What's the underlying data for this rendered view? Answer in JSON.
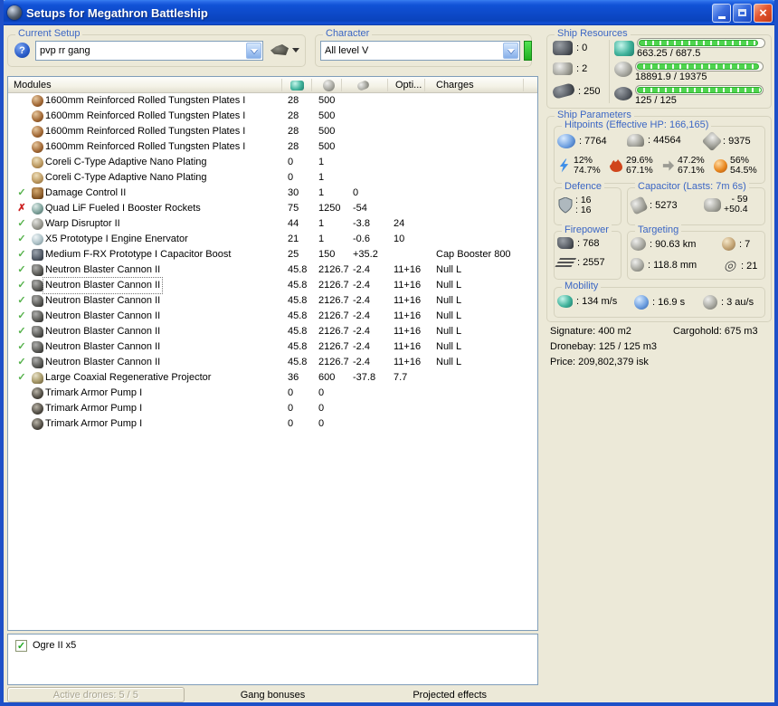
{
  "window_title": "Setups for Megathron Battleship",
  "current_setup": {
    "label": "Current Setup",
    "value": "pvp rr gang"
  },
  "character": {
    "label": "Character",
    "value": "All level V"
  },
  "modules_table": {
    "modules_header": "Modules",
    "opti_header": "Opti...",
    "charges_header": "Charges",
    "rows": [
      {
        "state": "",
        "icon": "armor-plate",
        "name": "1600mm Reinforced Rolled Tungsten Plates I",
        "cpu": "28",
        "pg": "500",
        "cap": "",
        "opti": "",
        "charges": ""
      },
      {
        "state": "",
        "icon": "armor-plate",
        "name": "1600mm Reinforced Rolled Tungsten Plates I",
        "cpu": "28",
        "pg": "500",
        "cap": "",
        "opti": "",
        "charges": ""
      },
      {
        "state": "",
        "icon": "armor-plate",
        "name": "1600mm Reinforced Rolled Tungsten Plates I",
        "cpu": "28",
        "pg": "500",
        "cap": "",
        "opti": "",
        "charges": ""
      },
      {
        "state": "",
        "icon": "armor-plate",
        "name": "1600mm Reinforced Rolled Tungsten Plates I",
        "cpu": "28",
        "pg": "500",
        "cap": "",
        "opti": "",
        "charges": ""
      },
      {
        "state": "",
        "icon": "adaptive-nano",
        "name": "Coreli C-Type Adaptive Nano Plating",
        "cpu": "0",
        "pg": "1",
        "cap": "",
        "opti": "",
        "charges": ""
      },
      {
        "state": "",
        "icon": "adaptive-nano",
        "name": "Coreli C-Type Adaptive Nano Plating",
        "cpu": "0",
        "pg": "1",
        "cap": "",
        "opti": "",
        "charges": ""
      },
      {
        "state": "check",
        "icon": "damage-control",
        "name": "Damage Control II",
        "cpu": "30",
        "pg": "1",
        "cap": "0",
        "opti": "",
        "charges": ""
      },
      {
        "state": "cross",
        "icon": "booster-rockets",
        "name": "Quad LiF Fueled I Booster Rockets",
        "cpu": "75",
        "pg": "1250",
        "cap": "-54",
        "opti": "",
        "charges": ""
      },
      {
        "state": "check",
        "icon": "warp-disruptor",
        "name": "Warp Disruptor II",
        "cpu": "44",
        "pg": "1",
        "cap": "-3.8",
        "opti": "24",
        "charges": ""
      },
      {
        "state": "check",
        "icon": "stasis-web",
        "name": "X5 Prototype I Engine Enervator",
        "cpu": "21",
        "pg": "1",
        "cap": "-0.6",
        "opti": "10",
        "charges": ""
      },
      {
        "state": "check",
        "icon": "cap-booster",
        "name": "Medium F-RX Prototype I Capacitor Boost",
        "cpu": "25",
        "pg": "150",
        "cap": "+35.2",
        "opti": "",
        "charges": "Cap Booster 800"
      },
      {
        "state": "check",
        "icon": "blaster-turret",
        "name": "Neutron Blaster Cannon II",
        "cpu": "45.8",
        "pg": "2126.7",
        "cap": "-2.4",
        "opti": "11+16",
        "charges": "Null L"
      },
      {
        "state": "check",
        "icon": "blaster-turret",
        "name": "Neutron Blaster Cannon II",
        "cpu": "45.8",
        "pg": "2126.7",
        "cap": "-2.4",
        "opti": "11+16",
        "charges": "Null L",
        "focused": true
      },
      {
        "state": "check",
        "icon": "blaster-turret",
        "name": "Neutron Blaster Cannon II",
        "cpu": "45.8",
        "pg": "2126.7",
        "cap": "-2.4",
        "opti": "11+16",
        "charges": "Null L"
      },
      {
        "state": "check",
        "icon": "blaster-turret",
        "name": "Neutron Blaster Cannon II",
        "cpu": "45.8",
        "pg": "2126.7",
        "cap": "-2.4",
        "opti": "11+16",
        "charges": "Null L"
      },
      {
        "state": "check",
        "icon": "blaster-turret",
        "name": "Neutron Blaster Cannon II",
        "cpu": "45.8",
        "pg": "2126.7",
        "cap": "-2.4",
        "opti": "11+16",
        "charges": "Null L"
      },
      {
        "state": "check",
        "icon": "blaster-turret",
        "name": "Neutron Blaster Cannon II",
        "cpu": "45.8",
        "pg": "2126.7",
        "cap": "-2.4",
        "opti": "11+16",
        "charges": "Null L"
      },
      {
        "state": "check",
        "icon": "blaster-turret",
        "name": "Neutron Blaster Cannon II",
        "cpu": "45.8",
        "pg": "2126.7",
        "cap": "-2.4",
        "opti": "11+16",
        "charges": "Null L"
      },
      {
        "state": "check",
        "icon": "remote-repairer",
        "name": "Large Coaxial Regenerative Projector",
        "cpu": "36",
        "pg": "600",
        "cap": "-37.8",
        "opti": "7.7",
        "charges": ""
      },
      {
        "state": "",
        "icon": "armor-rig",
        "name": "Trimark Armor Pump I",
        "cpu": "0",
        "pg": "0",
        "cap": "",
        "opti": "",
        "charges": ""
      },
      {
        "state": "",
        "icon": "armor-rig",
        "name": "Trimark Armor Pump I",
        "cpu": "0",
        "pg": "0",
        "cap": "",
        "opti": "",
        "charges": ""
      },
      {
        "state": "",
        "icon": "armor-rig",
        "name": "Trimark Armor Pump I",
        "cpu": "0",
        "pg": "0",
        "cap": "",
        "opti": "",
        "charges": ""
      }
    ]
  },
  "drones_panel": {
    "items": [
      {
        "checked": true,
        "label": "Ogre II x5"
      }
    ]
  },
  "bottom_tabs": {
    "active_drones": "Active drones: 5 / 5",
    "gang_bonuses": "Gang bonuses",
    "projected_effects": "Projected effects"
  },
  "ship_resources": {
    "label": "Ship Resources",
    "turret_slots": ": 0",
    "launcher_slots": ": 2",
    "calibration": ": 250",
    "cpu_text": "663.25 / 687.5",
    "cpu_pct": 96,
    "powergrid_text": "18891.9 / 19375",
    "powergrid_pct": 98,
    "drone_bandwidth_text": "125 / 125",
    "drone_bandwidth_pct": 100
  },
  "ship_parameters": {
    "label": "Ship Parameters",
    "hitpoints": {
      "label": "Hitpoints (Effective HP: 166,165)",
      "shield_hp": ": 7764",
      "armor_hp": ": 44564",
      "hull_hp": ": 9375",
      "resists": [
        {
          "top": "12%",
          "bottom": "74.7%"
        },
        {
          "top": "29.6%",
          "bottom": "67.1%"
        },
        {
          "top": "47.2%",
          "bottom": "67.1%"
        },
        {
          "top": "56%",
          "bottom": "54.5%"
        }
      ]
    },
    "defence": {
      "label": "Defence",
      "value_top": ": 16",
      "value_bottom": ": 16"
    },
    "capacitor": {
      "label": "Capacitor (Lasts: 7m 6s)",
      "amount": ": 5273",
      "usage_top": "- 59",
      "usage_bottom": "+50.4"
    },
    "firepower": {
      "label": "Firepower",
      "volley": ": 768",
      "dps": ": 2557"
    },
    "targeting": {
      "label": "Targeting",
      "range": ": 90.63 km",
      "max_targets": ": 7",
      "scan_resolution": ": 118.8 mm",
      "sensor_strength": ": 21"
    },
    "mobility": {
      "label": "Mobility",
      "speed": ": 134 m/s",
      "align_time": ": 16.9 s",
      "warp_speed": ": 3 au/s"
    }
  },
  "summary": {
    "signature": "Signature: 400 m2",
    "cargohold": "Cargohold: 675 m3",
    "dronebay": "Dronebay: 125 / 125 m3",
    "price": "Price: 209,802,379 isk"
  },
  "colors": {
    "title_blue": "#0D49C8",
    "caption_blue": "#3B66C4",
    "bar_green": "#4ED44E"
  }
}
